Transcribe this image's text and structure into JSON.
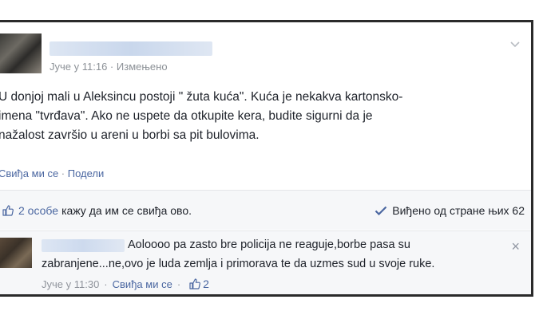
{
  "post": {
    "time": "Јуче у 11:16",
    "separator": "·",
    "edited": "Измењено",
    "text_lines": [
      "U donjoj mali u Aleksincu postoji \" žuta kuća\". Kuća je nekakva kartonsko-",
      "imena \"tvrđava\". Ako ne uspete da otkupite kera, budite sigurni da je",
      "nažalost završio u areni u borbi sa pit bulovima."
    ],
    "like_action": "Свиђа ми се",
    "share_action": "Подели"
  },
  "likes_bar": {
    "count_label": "2 особе",
    "likes_text": "кажу да им се свиђа ово.",
    "seen_text": "Виђено од стране њих 62"
  },
  "comment": {
    "line1": "Aoloooo pa zasto bre policija ne reaguje,borbe pasa su",
    "line2": "zabranjene...ne,ovo je luda zemlja i primorava te da uzmes sud u svoje ruke.",
    "time": "Јуче у 11:30",
    "like_action": "Свиђа ми се",
    "like_count": "2",
    "close_symbol": "×"
  },
  "colors": {
    "link": "#4b67a1",
    "muted": "#90949c",
    "bar_bg": "#f6f7f9"
  },
  "icons": [
    "chevron-down-icon",
    "thumbs-up-icon",
    "checkmark-icon",
    "close-icon"
  ]
}
